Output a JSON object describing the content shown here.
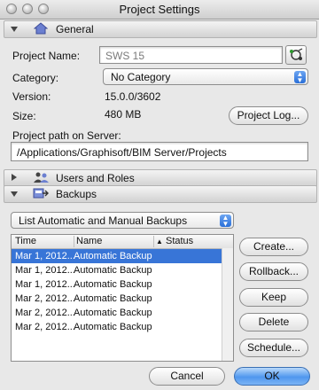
{
  "window": {
    "title": "Project Settings"
  },
  "general": {
    "header": "General",
    "project_name_label": "Project Name:",
    "project_name_value": "SWS 15",
    "category_label": "Category:",
    "category_value": "No Category",
    "version_label": "Version:",
    "version_value": "15.0.0/3602",
    "size_label": "Size:",
    "size_value": "480 MB",
    "project_log_button": "Project Log...",
    "path_label": "Project path on Server:",
    "path_value": "/Applications/Graphisoft/BIM Server/Projects"
  },
  "users_roles": {
    "header": "Users and Roles"
  },
  "backups": {
    "header": "Backups",
    "filter_value": "List Automatic and Manual Backups",
    "columns": [
      "Time",
      "Name",
      "Status"
    ],
    "rows": [
      {
        "time": "Mar 1, 2012...",
        "name": "Automatic Backup",
        "status": "",
        "selected": true
      },
      {
        "time": "Mar 1, 2012...",
        "name": "Automatic Backup",
        "status": "",
        "selected": false
      },
      {
        "time": "Mar 1, 2012...",
        "name": "Automatic Backup",
        "status": "",
        "selected": false
      },
      {
        "time": "Mar 2, 2012...",
        "name": "Automatic Backup",
        "status": "",
        "selected": false
      },
      {
        "time": "Mar 2, 2012...",
        "name": "Automatic Backup",
        "status": "",
        "selected": false
      },
      {
        "time": "Mar 2, 2012...",
        "name": "Automatic Backup",
        "status": "",
        "selected": false
      }
    ],
    "buttons": {
      "create": "Create...",
      "rollback": "Rollback...",
      "keep": "Keep",
      "delete": "Delete",
      "schedule": "Schedule..."
    }
  },
  "footer": {
    "cancel": "Cancel",
    "ok": "OK"
  }
}
